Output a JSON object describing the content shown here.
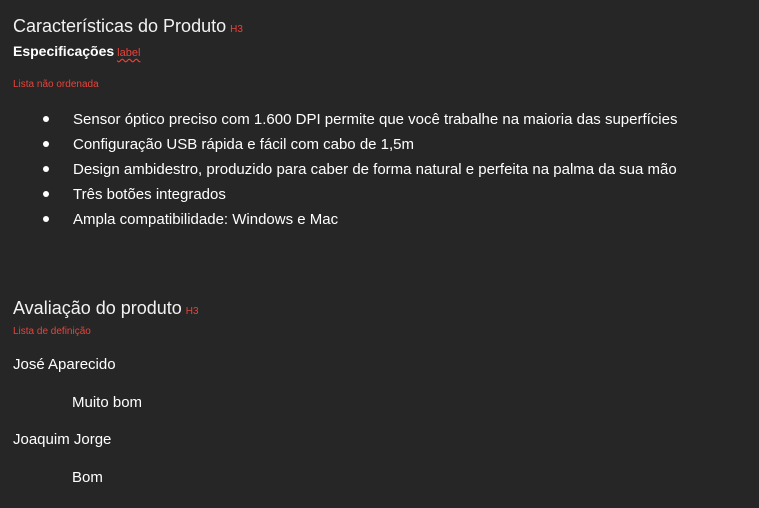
{
  "section1": {
    "heading": "Características do Produto",
    "heading_tag": "H3",
    "label_text": "Especificações",
    "label_tag": "label",
    "list_note": "Lista não ordenada",
    "items": [
      "Sensor óptico preciso com 1.600 DPI permite que você trabalhe na maioria das superfícies",
      "Configuração USB rápida e fácil com cabo de 1,5m",
      "Design ambidestro, produzido para caber de forma natural e perfeita na palma da sua mão",
      "Três botões integrados",
      "Ampla compatibilidade: Windows e Mac"
    ]
  },
  "section2": {
    "heading": "Avaliação do produto",
    "heading_tag": "H3",
    "list_note": "Lista de definição",
    "reviews": [
      {
        "name": "José Aparecido",
        "rating": "Muito bom"
      },
      {
        "name": "Joaquim Jorge",
        "rating": "Bom"
      }
    ]
  },
  "colors": {
    "background": "#262626",
    "text": "#ffffff",
    "annotation": "#e8433b"
  }
}
